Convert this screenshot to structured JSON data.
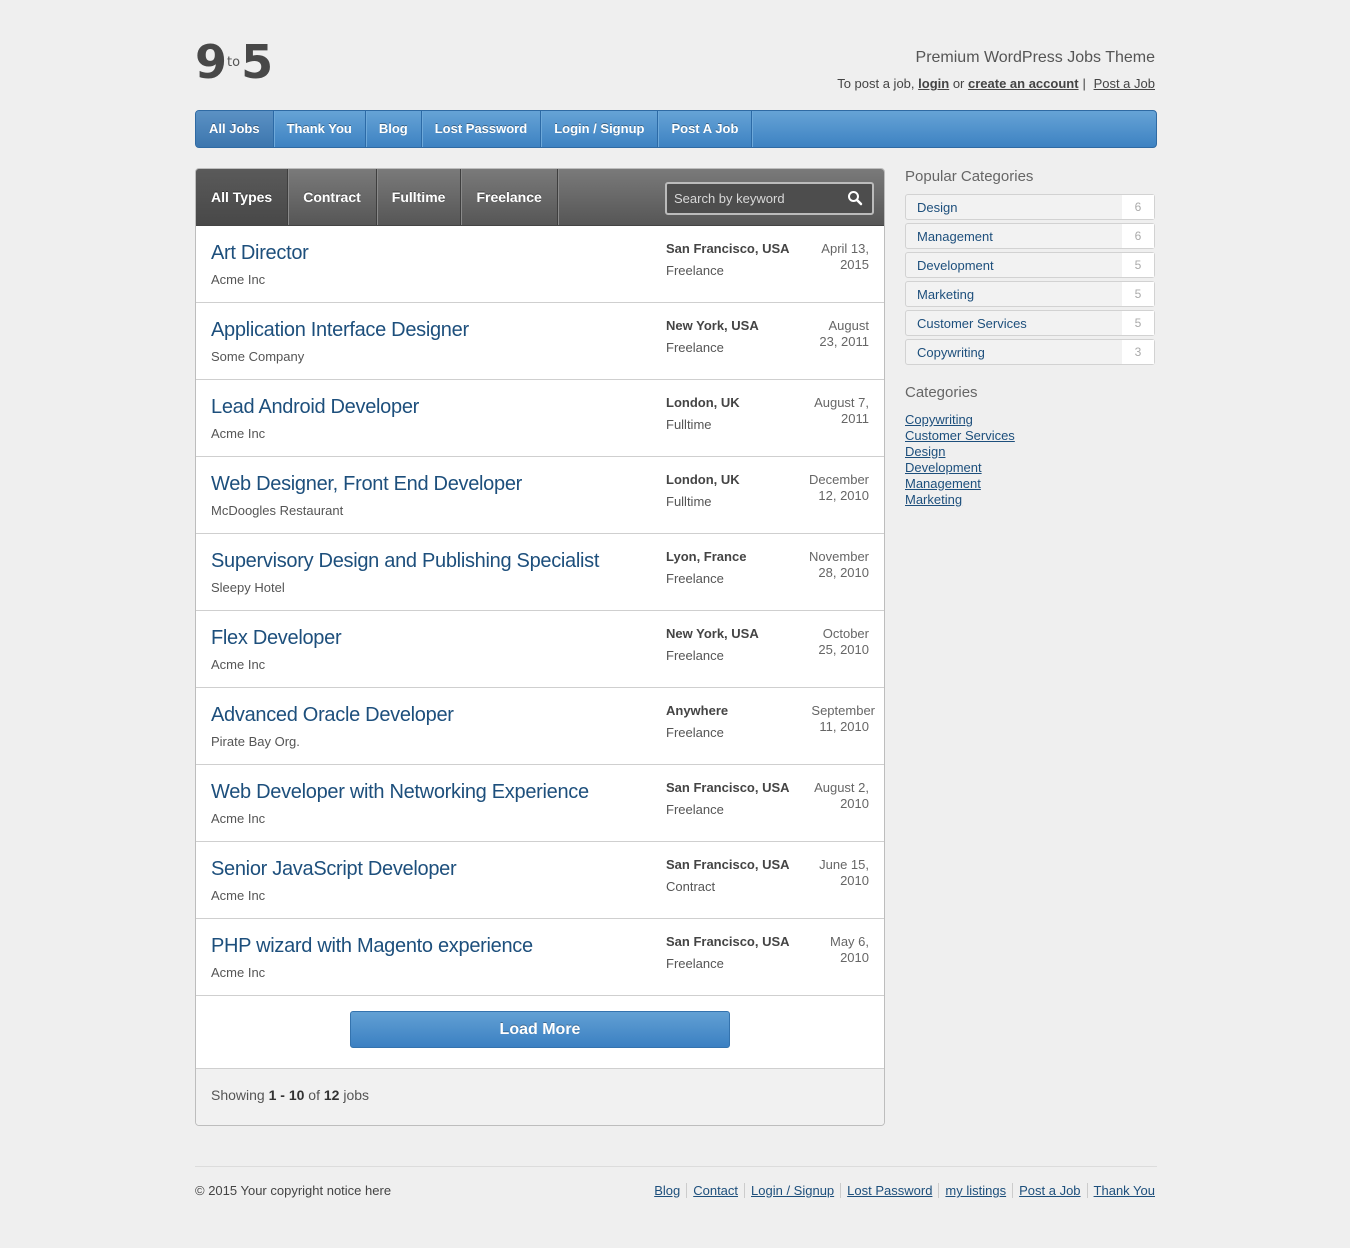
{
  "header": {
    "logo": {
      "left": "9",
      "middle": "to",
      "right": "5"
    },
    "tagline": "Premium WordPress Jobs Theme",
    "post_prefix": "To post a job,",
    "login_label": "login",
    "or_text": "or",
    "create_account_label": "create an account",
    "separator": "|",
    "post_job_label": "Post a Job"
  },
  "nav": {
    "items": [
      {
        "label": "All Jobs",
        "active": true
      },
      {
        "label": "Thank You"
      },
      {
        "label": "Blog"
      },
      {
        "label": "Lost Password"
      },
      {
        "label": "Login / Signup"
      },
      {
        "label": "Post A Job"
      }
    ]
  },
  "filters": {
    "items": [
      {
        "label": "All Types",
        "active": true
      },
      {
        "label": "Contract"
      },
      {
        "label": "Fulltime"
      },
      {
        "label": "Freelance"
      }
    ],
    "search_placeholder": "Search by keyword",
    "search_icon": "magnifier-icon"
  },
  "jobs": [
    {
      "title": "Art Director",
      "company": "Acme Inc",
      "location": "San Francisco, USA",
      "type": "Freelance",
      "date_line1": "April 13,",
      "date_line2": "2015"
    },
    {
      "title": "Application Interface Designer",
      "company": "Some Company",
      "location": "New York, USA",
      "type": "Freelance",
      "date_line1": "August",
      "date_line2": "23, 2011"
    },
    {
      "title": "Lead Android Developer",
      "company": "Acme Inc",
      "location": "London, UK",
      "type": "Fulltime",
      "date_line1": "August 7,",
      "date_line2": "2011"
    },
    {
      "title": "Web Designer, Front End Developer",
      "company": "McDoogles Restaurant",
      "location": "London, UK",
      "type": "Fulltime",
      "date_line1": "December",
      "date_line2": "12, 2010"
    },
    {
      "title": "Supervisory Design and Publishing Specialist",
      "company": "Sleepy Hotel",
      "location": "Lyon, France",
      "type": "Freelance",
      "date_line1": "November",
      "date_line2": "28, 2010"
    },
    {
      "title": "Flex Developer",
      "company": "Acme Inc",
      "location": "New York, USA",
      "type": "Freelance",
      "date_line1": "October",
      "date_line2": "25, 2010"
    },
    {
      "title": "Advanced Oracle Developer",
      "company": "Pirate Bay Org.",
      "location": "Anywhere",
      "type": "Freelance",
      "date_line1": "September",
      "date_line2": "11, 2010"
    },
    {
      "title": "Web Developer with Networking Experience",
      "company": "Acme Inc",
      "location": "San Francisco, USA",
      "type": "Freelance",
      "date_line1": "August 2,",
      "date_line2": "2010"
    },
    {
      "title": "Senior JavaScript Developer",
      "company": "Acme Inc",
      "location": "San Francisco, USA",
      "type": "Contract",
      "date_line1": "June 15,",
      "date_line2": "2010"
    },
    {
      "title": "PHP wizard with Magento experience",
      "company": "Acme Inc",
      "location": "San Francisco, USA",
      "type": "Freelance",
      "date_line1": "May 6,",
      "date_line2": "2010"
    }
  ],
  "load_more_label": "Load More",
  "showing": {
    "prefix": "Showing",
    "range": "1 - 10",
    "of": "of",
    "total": "12",
    "suffix": "jobs"
  },
  "sidebar": {
    "popular_title": "Popular Categories",
    "popular": [
      {
        "name": "Design",
        "count": "6"
      },
      {
        "name": "Management",
        "count": "6"
      },
      {
        "name": "Development",
        "count": "5"
      },
      {
        "name": "Marketing",
        "count": "5"
      },
      {
        "name": "Customer Services",
        "count": "5"
      },
      {
        "name": "Copywriting",
        "count": "3"
      }
    ],
    "categories_title": "Categories",
    "categories": [
      "Copywriting",
      "Customer Services",
      "Design",
      "Development",
      "Management",
      "Marketing"
    ]
  },
  "footer": {
    "copyright": "© 2015 Your copyright notice here",
    "links": [
      "Blog",
      "Contact",
      "Login / Signup",
      "Lost Password",
      "my listings",
      "Post a Job",
      "Thank You"
    ]
  },
  "colors": {
    "nav_blue": "#4a8cca",
    "link_blue": "#1d4f7c",
    "filter_dark": "#5a5a5a"
  }
}
